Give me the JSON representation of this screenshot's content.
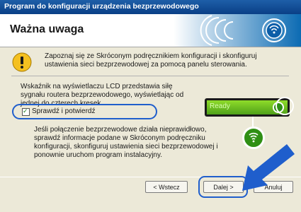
{
  "window": {
    "title": "Program do konfiguracji urządzenia bezprzewodowego"
  },
  "header": {
    "title": "Ważna uwaga"
  },
  "content": {
    "warning_text": "Zapoznaj się ze Skróconym podręcznikiem konfiguracji i skonfiguruj ustawienia sieci bezprzewodowej za pomocą panelu sterowania.",
    "lcd_info_text": "Wskaźnik na wyświetlaczu LCD przedstawia siłę sygnału routera bezprzewodowego, wyświetlając od jednej do czterech kresek.",
    "lcd_label": "Ready",
    "checkbox_label": "Sprawdź i potwierdź",
    "checkbox_checked": true,
    "failure_text": "Jeśli połączenie bezprzewodowe działa nieprawidłowo, sprawdź informacje podane w Skróconym podręczniku konfiguracji, skonfiguruj ustawienia sieci bezprzewodowej i ponownie uruchom program instalacyjny."
  },
  "buttons": {
    "back": "< Wstecz",
    "next": "Dalej >",
    "cancel": "Anuluj"
  },
  "colors": {
    "title_bar": "#0a3f86",
    "highlight": "#1f5ecc",
    "lcd_green": "#6cc42a"
  },
  "icons": {
    "header_logo": "wireless-signal-logo-icon",
    "warning": "warning-exclamation-icon",
    "signal": "wireless-signal-icon",
    "pointer": "blue-arrow-icon"
  }
}
